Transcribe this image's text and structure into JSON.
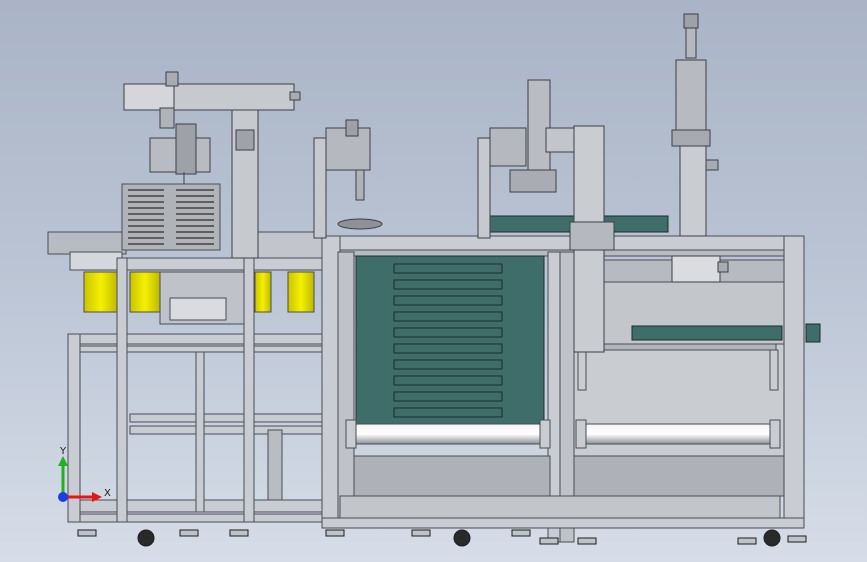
{
  "viewport": {
    "background_top": "#a9b4c6",
    "background_bottom": "#d6dde8"
  },
  "colors": {
    "frame": "#c9ccd2",
    "frame_edge": "#4a4d55",
    "panel": "#a2a5ab",
    "drawer": "#3f6e6a",
    "yellow": "#e6e000",
    "dark": "#2a2a2a"
  },
  "triad": {
    "y_label": "Y",
    "x_label": "X",
    "y_color": "#1db31d",
    "x_color": "#e01818",
    "z_color": "#1a3ee0"
  }
}
